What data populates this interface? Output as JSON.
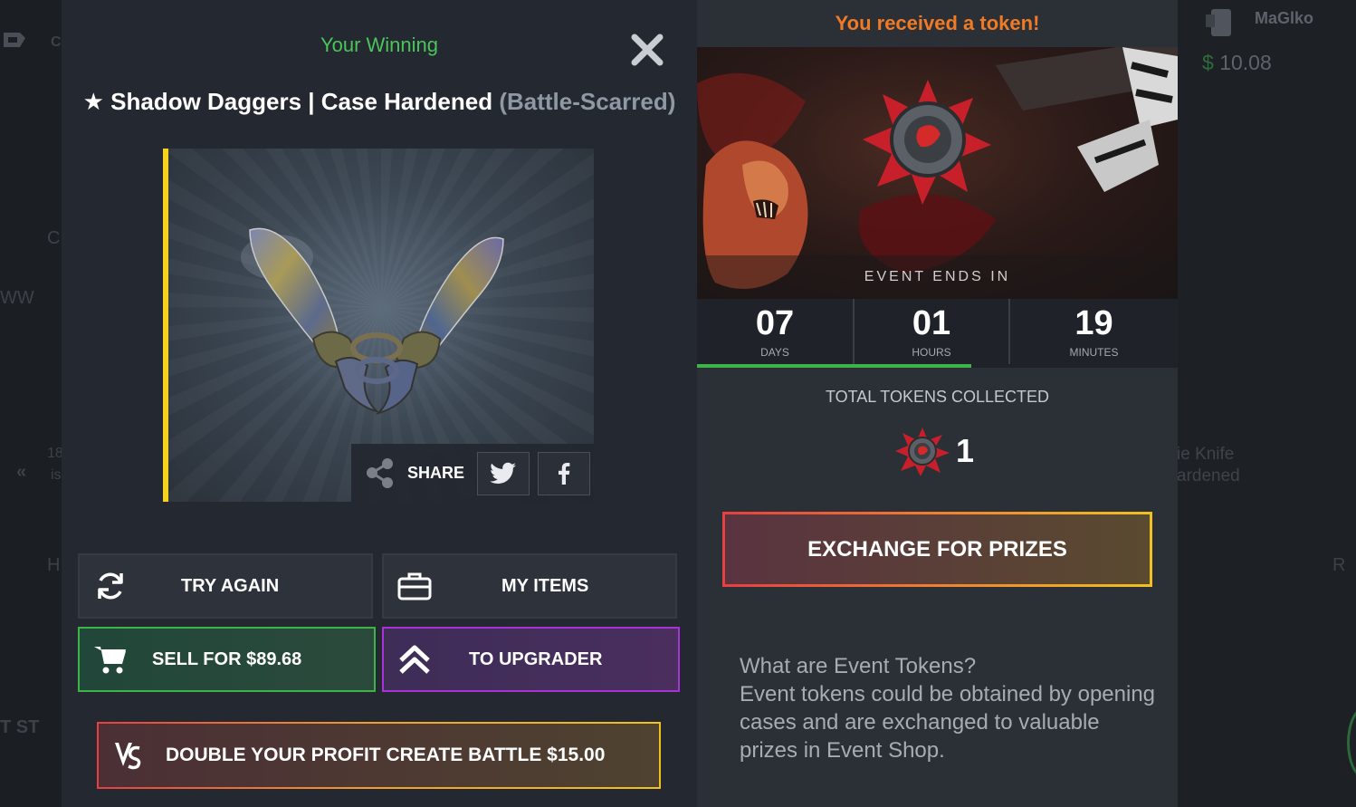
{
  "background": {
    "user": {
      "name": "MaGlko",
      "balance_currency": "$",
      "balance_value": "10.08"
    },
    "fragments": {
      "frag_c1": "C",
      "frag_c2": "C",
      "frag_ww": "WW",
      "frag_h": "H",
      "frag_st": "T ST",
      "frag_r": "R",
      "frag_18": "18",
      "frag_is": "is"
    },
    "side_item_text": [
      "ie Knife",
      "ardened"
    ]
  },
  "winning_modal": {
    "title": "Your Winning",
    "item": {
      "name": "★ Shadow Daggers | Case Hardened",
      "condition": "(Battle-Scarred)",
      "rarity_color": "#f4d21e"
    },
    "share": {
      "label": "SHARE",
      "networks": [
        "twitter",
        "facebook"
      ]
    },
    "buttons": {
      "try_again": "TRY AGAIN",
      "my_items": "MY ITEMS",
      "sell": "SELL FOR $89.68",
      "upgrader": "TO UPGRADER",
      "battle": "DOUBLE YOUR PROFIT CREATE BATTLE $15.00"
    },
    "icons": {
      "try_again": "refresh-icon",
      "my_items": "briefcase-icon",
      "sell": "cart-icon",
      "upgrader": "chevrons-up-icon",
      "battle": "vs-icon",
      "close": "close-icon"
    }
  },
  "token_modal": {
    "title": "You received a token!",
    "event_ends_label": "EVENT ENDS IN",
    "countdown": [
      {
        "value": "07",
        "unit": "DAYS"
      },
      {
        "value": "01",
        "unit": "HOURS"
      },
      {
        "value": "19",
        "unit": "MINUTES"
      }
    ],
    "countdown_progress_fraction": 0.57,
    "tokens_label": "TOTAL TOKENS COLLECTED",
    "tokens_count": "1",
    "exchange_button": "EXCHANGE FOR PRIZES",
    "faq": {
      "question": "What are Event Tokens?",
      "answer": "Event tokens could be obtained by opening cases and are exchanged to valuable prizes in Event Shop."
    }
  },
  "colors": {
    "win_title": "#4bc45a",
    "token_title": "#f07a25",
    "sell_border": "#3cb448",
    "upgrader_border": "#a932d6",
    "battle_gradient": [
      "#e64040",
      "#f0a030",
      "#f0c020"
    ]
  }
}
